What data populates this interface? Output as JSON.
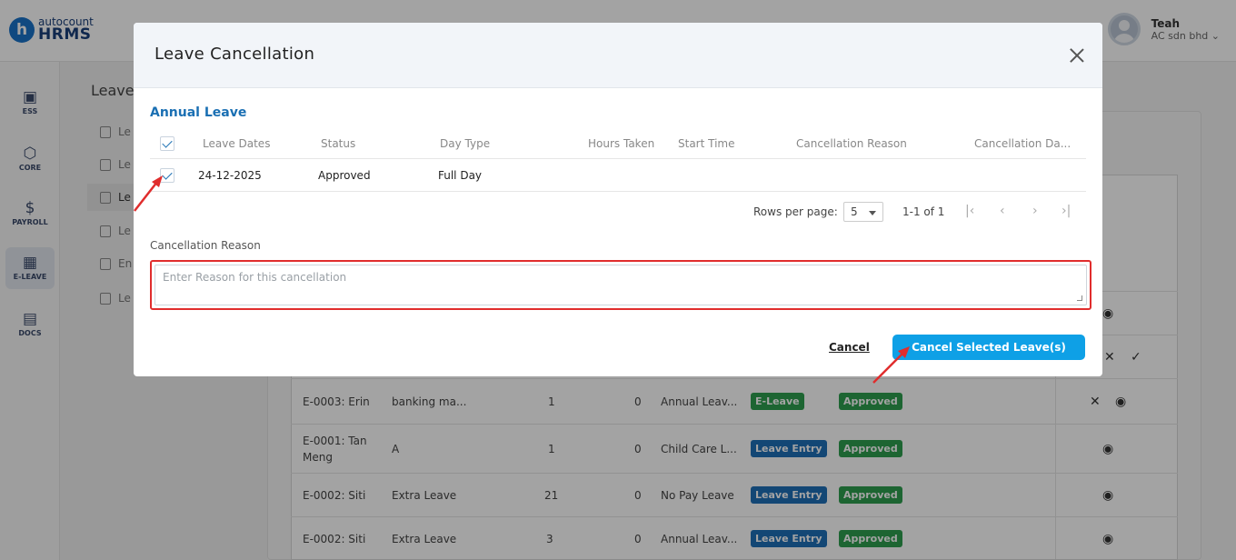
{
  "brand": {
    "top": "autocount",
    "bottom": "HRMS"
  },
  "user": {
    "name": "Teah",
    "company": "AC sdn bhd ⌄"
  },
  "sidebar": {
    "items": [
      {
        "label": "ESS",
        "icon": "ess-icon",
        "glyph": "▣"
      },
      {
        "label": "CORE",
        "icon": "core-icon",
        "glyph": "⬡"
      },
      {
        "label": "PAYROLL",
        "icon": "payroll-icon",
        "glyph": "$"
      },
      {
        "label": "E-LEAVE",
        "icon": "calendar-icon",
        "glyph": "▦"
      },
      {
        "label": "DOCS",
        "icon": "docs-icon",
        "glyph": "▤"
      }
    ]
  },
  "subnav": {
    "title": "Leave",
    "items": [
      "Le",
      "Le",
      "Le",
      "Le",
      "En",
      "Le"
    ]
  },
  "background_table": {
    "rows": [
      {
        "employee": "E-0003: Erin",
        "reason": "banking ma...",
        "days": "1",
        "hours": "0",
        "leave_type": "Annual Leav...",
        "source": "E-Leave",
        "status": "Approved"
      },
      {
        "employee": "E-0001: Tan Meng",
        "reason": "A",
        "days": "1",
        "hours": "0",
        "leave_type": "Child Care L...",
        "source": "Leave Entry",
        "status": "Approved"
      },
      {
        "employee": "E-0002: Siti",
        "reason": "Extra Leave",
        "days": "21",
        "hours": "0",
        "leave_type": "No Pay Leave",
        "source": "Leave Entry",
        "status": "Approved"
      },
      {
        "employee": "E-0002: Siti",
        "reason": "Extra Leave",
        "days": "3",
        "hours": "0",
        "leave_type": "Annual Leav...",
        "source": "Leave Entry",
        "status": "Approved"
      }
    ]
  },
  "modal": {
    "title": "Leave Cancellation",
    "section_title": "Annual Leave",
    "columns": [
      "Leave Dates",
      "Status",
      "Day Type",
      "Hours Taken",
      "Start Time",
      "Cancellation Reason",
      "Cancellation Da..."
    ],
    "rows": [
      {
        "checked": true,
        "leave_date": "24-12-2025",
        "status": "Approved",
        "day_type": "Full Day",
        "hours_taken": "",
        "start_time": "",
        "cancellation_reason": "",
        "cancellation_date": ""
      }
    ],
    "pagination": {
      "rows_per_page_label": "Rows per page:",
      "rows_per_page_value": "5",
      "range": "1-1 of 1"
    },
    "reason_label": "Cancellation Reason",
    "reason_placeholder": "Enter Reason for this cancellation",
    "reason_value": "",
    "cancel_label": "Cancel",
    "submit_label": "Cancel Selected Leave(s)"
  },
  "colors": {
    "accent": "#0ea0e6",
    "title_blue": "#1a6fb3",
    "highlight_red": "#e02d2d",
    "approved_green": "#2e9e4f",
    "entry_blue": "#1f6fb8"
  }
}
